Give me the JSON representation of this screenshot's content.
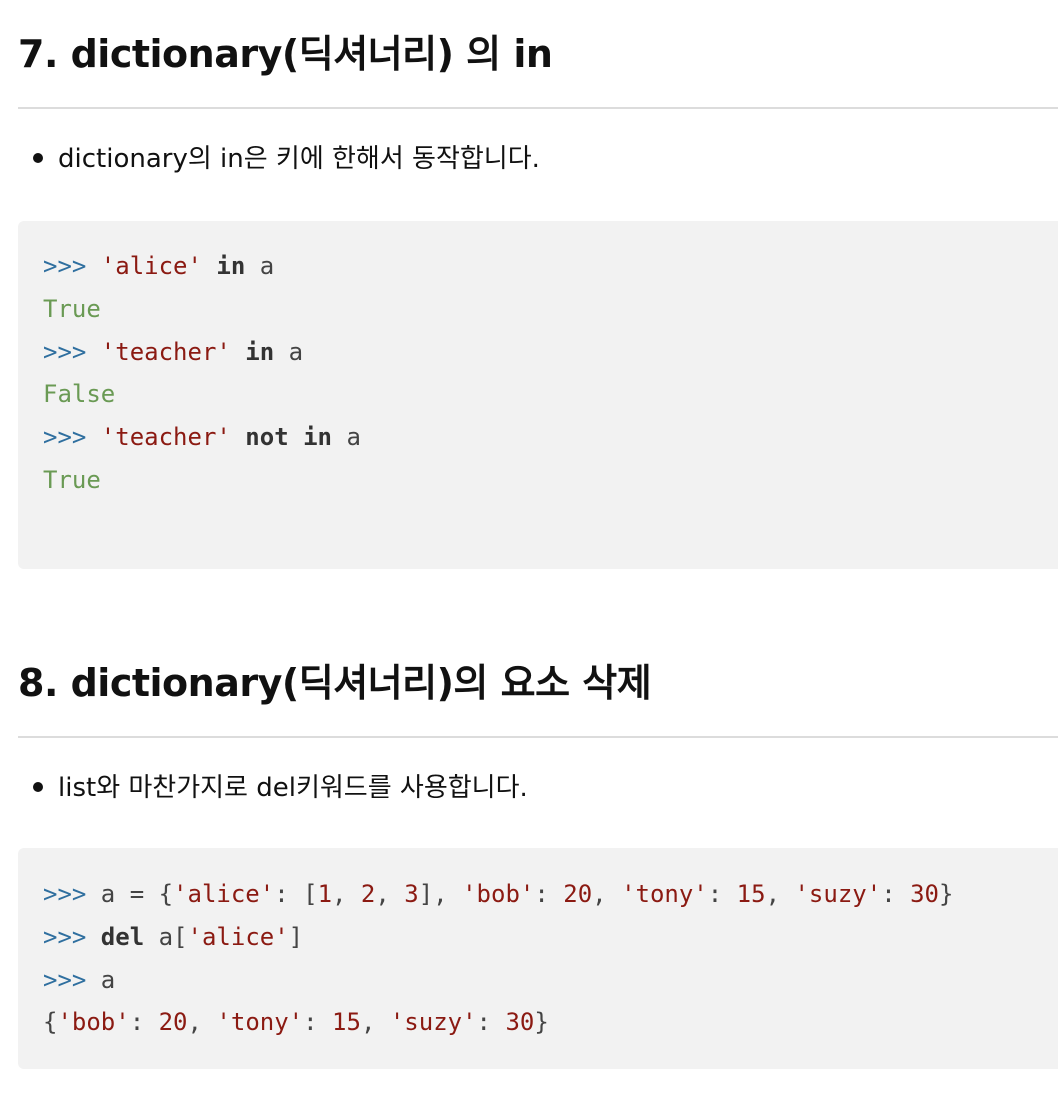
{
  "sections": [
    {
      "title": "7. dictionary(딕셔너리) 의 in",
      "bullet": "dictionary의 in은 키에 한해서 동작합니다.",
      "code": [
        [
          {
            "c": "p",
            "t": ">>> "
          },
          {
            "c": "s",
            "t": "'alice'"
          },
          {
            "c": "t",
            "t": " "
          },
          {
            "c": "k",
            "t": "in"
          },
          {
            "c": "t",
            "t": " a"
          }
        ],
        [
          {
            "c": "o",
            "t": "True"
          }
        ],
        [
          {
            "c": "p",
            "t": ">>> "
          },
          {
            "c": "s",
            "t": "'teacher'"
          },
          {
            "c": "t",
            "t": " "
          },
          {
            "c": "k",
            "t": "in"
          },
          {
            "c": "t",
            "t": " a"
          }
        ],
        [
          {
            "c": "o",
            "t": "False"
          }
        ],
        [
          {
            "c": "p",
            "t": ">>> "
          },
          {
            "c": "s",
            "t": "'teacher'"
          },
          {
            "c": "t",
            "t": " "
          },
          {
            "c": "k",
            "t": "not"
          },
          {
            "c": "t",
            "t": " "
          },
          {
            "c": "k",
            "t": "in"
          },
          {
            "c": "t",
            "t": " a"
          }
        ],
        [
          {
            "c": "o",
            "t": "True"
          }
        ]
      ]
    },
    {
      "title": "8. dictionary(딕셔너리)의 요소 삭제",
      "bullet": "list와 마찬가지로 del키워드를 사용합니다.",
      "code": [
        [
          {
            "c": "p",
            "t": ">>> "
          },
          {
            "c": "t",
            "t": "a = {"
          },
          {
            "c": "s",
            "t": "'alice'"
          },
          {
            "c": "t",
            "t": ": ["
          },
          {
            "c": "n",
            "t": "1"
          },
          {
            "c": "t",
            "t": ", "
          },
          {
            "c": "n",
            "t": "2"
          },
          {
            "c": "t",
            "t": ", "
          },
          {
            "c": "n",
            "t": "3"
          },
          {
            "c": "t",
            "t": "], "
          },
          {
            "c": "s",
            "t": "'bob'"
          },
          {
            "c": "t",
            "t": ": "
          },
          {
            "c": "n",
            "t": "20"
          },
          {
            "c": "t",
            "t": ", "
          },
          {
            "c": "s",
            "t": "'tony'"
          },
          {
            "c": "t",
            "t": ": "
          },
          {
            "c": "n",
            "t": "15"
          },
          {
            "c": "t",
            "t": ", "
          },
          {
            "c": "s",
            "t": "'suzy'"
          },
          {
            "c": "t",
            "t": ": "
          },
          {
            "c": "n",
            "t": "30"
          },
          {
            "c": "t",
            "t": "}"
          }
        ],
        [
          {
            "c": "p",
            "t": ">>> "
          },
          {
            "c": "k",
            "t": "del"
          },
          {
            "c": "t",
            "t": " a["
          },
          {
            "c": "s",
            "t": "'alice'"
          },
          {
            "c": "t",
            "t": "]"
          }
        ],
        [
          {
            "c": "p",
            "t": ">>> "
          },
          {
            "c": "t",
            "t": "a"
          }
        ],
        [
          {
            "c": "t",
            "t": "{"
          },
          {
            "c": "s",
            "t": "'bob'"
          },
          {
            "c": "t",
            "t": ": "
          },
          {
            "c": "n",
            "t": "20"
          },
          {
            "c": "t",
            "t": ", "
          },
          {
            "c": "s",
            "t": "'tony'"
          },
          {
            "c": "t",
            "t": ": "
          },
          {
            "c": "n",
            "t": "15"
          },
          {
            "c": "t",
            "t": ", "
          },
          {
            "c": "s",
            "t": "'suzy'"
          },
          {
            "c": "t",
            "t": ": "
          },
          {
            "c": "n",
            "t": "30"
          },
          {
            "c": "t",
            "t": "}"
          }
        ]
      ]
    }
  ]
}
